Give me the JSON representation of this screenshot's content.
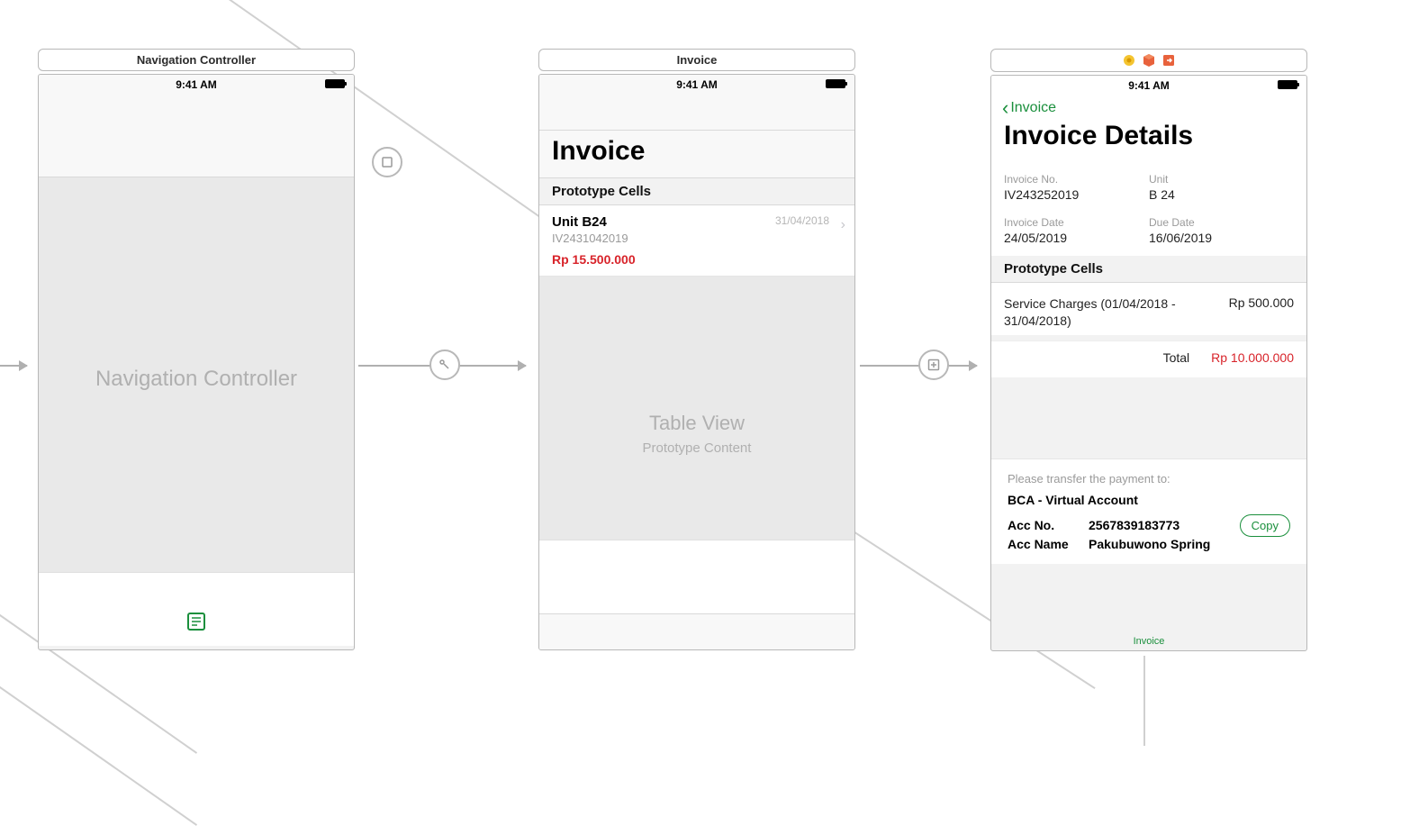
{
  "statusbar": {
    "time": "9:41 AM"
  },
  "scene1": {
    "title": "Navigation Controller",
    "placeholder": "Navigation Controller"
  },
  "scene2": {
    "title": "Invoice",
    "largeTitle": "Invoice",
    "sectionHeader": "Prototype Cells",
    "cell": {
      "unit": "Unit B24",
      "invoiceId": "IV2431042019",
      "price": "Rp 15.500.000",
      "date": "31/04/2018"
    },
    "tableViewLabel": "Table View",
    "tableViewSub": "Prototype Content"
  },
  "scene3": {
    "backLabel": "Invoice",
    "largeTitle": "Invoice Details",
    "fields": {
      "invoiceNoLabel": "Invoice No.",
      "invoiceNo": "IV243252019",
      "unitLabel": "Unit",
      "unit": "B 24",
      "invoiceDateLabel": "Invoice Date",
      "invoiceDate": "24/05/2019",
      "dueDateLabel": "Due Date",
      "dueDate": "16/06/2019"
    },
    "sectionHeader": "Prototype Cells",
    "charge": {
      "desc": "Service Charges (01/04/2018 - 31/04/2018)",
      "amount": "Rp 500.000"
    },
    "totalLabel": "Total",
    "totalAmount": "Rp 10.000.000",
    "payment": {
      "intro": "Please transfer the payment to:",
      "bank": "BCA - Virtual Account",
      "accNoLabel": "Acc No.",
      "accNo": "2567839183773",
      "accNameLabel": "Acc Name",
      "accName": "Pakubuwono Spring",
      "copy": "Copy"
    },
    "tabLabel": "Invoice"
  }
}
